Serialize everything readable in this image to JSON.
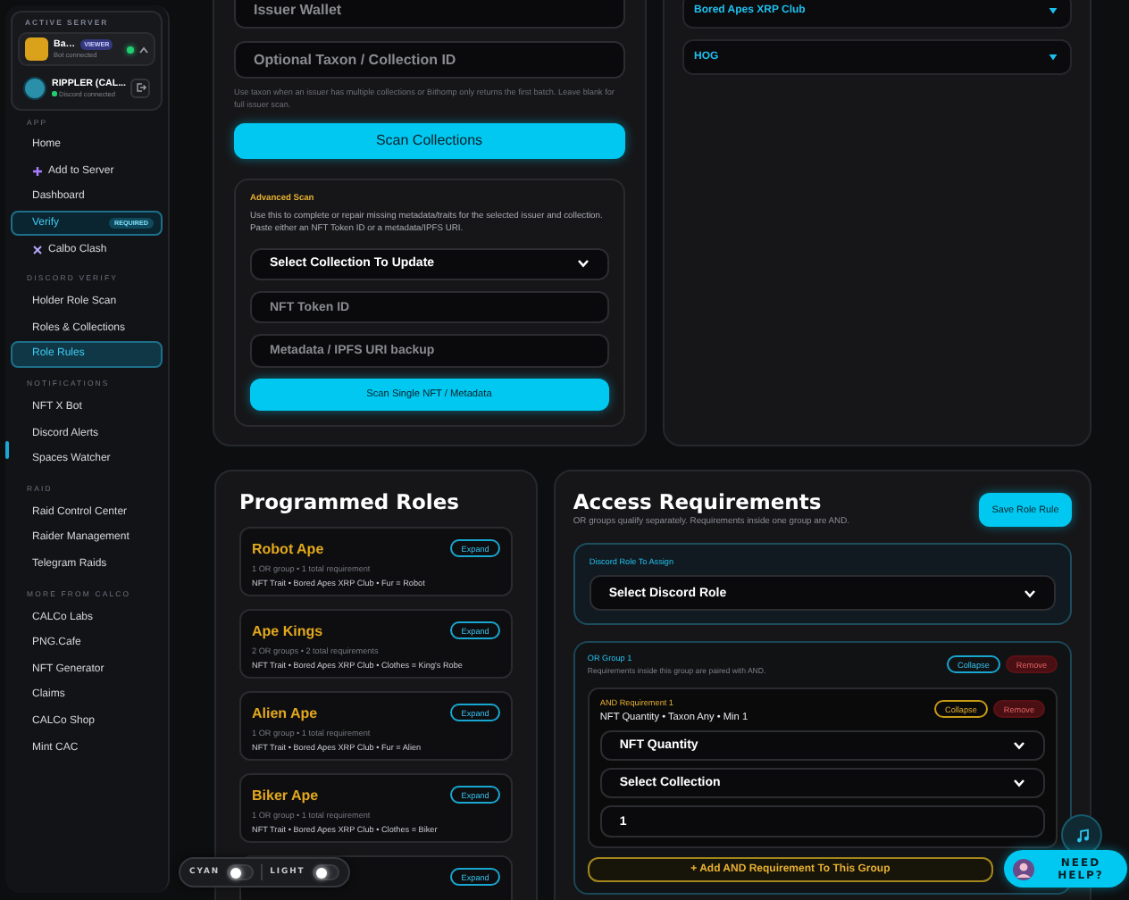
{
  "sidebar": {
    "active_server": {
      "label": "ACTIVE SERVER",
      "servers": [
        {
          "kind": "bot",
          "name": "Ba…",
          "badge": "VIEWER",
          "status": "Bot connected"
        },
        {
          "kind": "discord",
          "name": "RIPPLER (CAL...",
          "status": "Discord connected"
        }
      ]
    },
    "sections": [
      {
        "label": "APP",
        "items": [
          {
            "label": "Home",
            "kind": "plain",
            "selected": false
          },
          {
            "label": "Add to Server",
            "kind": "plus",
            "selected": false
          },
          {
            "label": "Dashboard",
            "kind": "plain",
            "selected": false
          },
          {
            "label": "Verify",
            "kind": "featured",
            "badge": "REQUIRED",
            "selected": false
          },
          {
            "label": "Calbo Clash",
            "kind": "cross",
            "selected": false
          }
        ]
      },
      {
        "label": "DISCORD VERIFY",
        "items": [
          {
            "label": "Holder Role Scan",
            "kind": "plain",
            "selected": false
          },
          {
            "label": "Roles & Collections",
            "kind": "plain",
            "selected": false
          },
          {
            "label": "Role Rules",
            "kind": "plain",
            "selected": true
          }
        ]
      },
      {
        "label": "NOTIFICATIONS",
        "items": [
          {
            "label": "NFT X Bot",
            "kind": "plain",
            "selected": false
          },
          {
            "label": "Discord Alerts",
            "kind": "plain",
            "selected": false
          },
          {
            "label": "Spaces Watcher",
            "kind": "plain",
            "selected": false
          }
        ]
      },
      {
        "label": "RAID",
        "items": [
          {
            "label": "Raid Control Center",
            "kind": "plain",
            "selected": false
          },
          {
            "label": "Raider Management",
            "kind": "plain",
            "selected": false
          },
          {
            "label": "Telegram Raids",
            "kind": "plain",
            "selected": false
          }
        ]
      },
      {
        "label": "MORE FROM CALCO",
        "items": [
          {
            "label": "CALCo Labs",
            "kind": "plain",
            "selected": false
          },
          {
            "label": "PNG.Cafe",
            "kind": "plain",
            "selected": false
          },
          {
            "label": "NFT Generator",
            "kind": "plain",
            "selected": false
          },
          {
            "label": "Claims",
            "kind": "plain",
            "selected": false
          },
          {
            "label": "CALCo Shop",
            "kind": "plain",
            "selected": false
          },
          {
            "label": "Mint CAC",
            "kind": "plain",
            "selected": false
          }
        ]
      }
    ]
  },
  "scan_panel": {
    "fields": [
      {
        "placeholder": "Issuer Wallet"
      },
      {
        "placeholder": "Optional Taxon / Collection ID"
      }
    ],
    "hint": "Use taxon when an issuer has multiple collections or Bithomp only returns the first batch. Leave blank for full issuer scan.",
    "scan_button": "Scan Collections",
    "advanced": {
      "label": "Advanced Scan",
      "description": "Use this to complete or repair missing metadata/traits for the selected issuer and collection. Paste either an NFT Token ID or a metadata/IPFS URI.",
      "select": "Select Collection To Update",
      "fields": [
        {
          "placeholder": "NFT Token ID"
        },
        {
          "placeholder": "Metadata / IPFS URI backup"
        }
      ],
      "button": "Scan Single NFT / Metadata"
    }
  },
  "collections": [
    {
      "name": "Bored Apes XRP Club"
    },
    {
      "name": "HOG"
    }
  ],
  "programmed_roles": {
    "title": "Programmed Roles",
    "roles": [
      {
        "name": "Robot Ape",
        "summary": "1 OR group • 1 total requirement",
        "detail": "NFT Trait • Bored Apes XRP Club • Fur = Robot",
        "expand": "Expand"
      },
      {
        "name": "Ape Kings",
        "summary": "2 OR groups • 2 total requirements",
        "detail": "NFT Trait • Bored Apes XRP Club • Clothes = King's Robe",
        "expand": "Expand"
      },
      {
        "name": "Alien Ape",
        "summary": "1 OR group • 1 total requirement",
        "detail": "NFT Trait • Bored Apes XRP Club • Fur = Alien",
        "expand": "Expand"
      },
      {
        "name": "Biker Ape",
        "summary": "1 OR group • 1 total requirement",
        "detail": "NFT Trait • Bored Apes XRP Club • Clothes = Biker",
        "expand": "Expand"
      },
      {
        "expand": "Expand"
      }
    ]
  },
  "access": {
    "title": "Access Requirements",
    "subtitle": "OR groups qualify separately. Requirements inside one group are AND.",
    "save_button": "Save Role Rule",
    "role_select": {
      "label": "Discord Role To Assign",
      "value": "Select Discord Role"
    },
    "or_groups": [
      {
        "label": "OR Group 1",
        "note": "Requirements inside this group are paired with AND.",
        "collapse": "Collapse",
        "remove": "Remove",
        "requirements": [
          {
            "label": "AND Requirement 1",
            "summary": "NFT Quantity • Taxon Any • Min 1",
            "collapse": "Collapse",
            "remove": "Remove",
            "type_select": "NFT Quantity",
            "collection_select": "Select Collection",
            "min_value": "1"
          }
        ],
        "add_button": "+ Add AND Requirement To This Group"
      }
    ]
  },
  "theme_toggles": [
    {
      "label": "CYAN",
      "on": false
    },
    {
      "label": "LIGHT",
      "on": false
    }
  ],
  "help_button": "NEED HELP?"
}
